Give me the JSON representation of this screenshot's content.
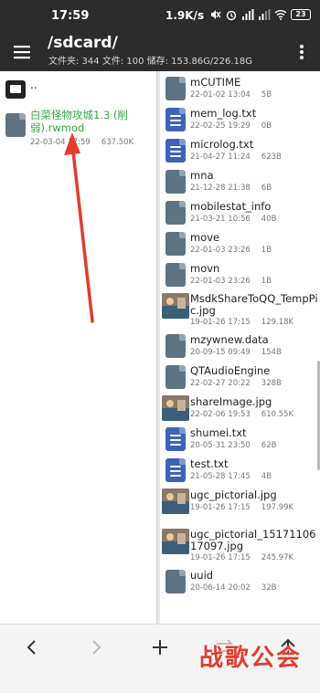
{
  "status_bar": {
    "time": "17:59",
    "net_speed": "1.9K/s",
    "battery": "23"
  },
  "app_bar": {
    "path": "/sdcard/",
    "storage_info": "文件夹: 344   文件: 100   储存: 153.86G/226.18G"
  },
  "left_panel": {
    "parent_label": "..",
    "file": {
      "name": "白菜怪物攻城1.3 (削弱).rwmod",
      "date": "22-03-04 17:59",
      "size": "637.50K"
    }
  },
  "right_panel": {
    "files": [
      {
        "name": "mCUTIME",
        "date": "22-01-02 13:04",
        "size": "5B",
        "icon": "plain"
      },
      {
        "name": "mem_log.txt",
        "date": "22-02-25 19:29",
        "size": "0B",
        "icon": "text"
      },
      {
        "name": "microlog.txt",
        "date": "21-04-27 11:24",
        "size": "623B",
        "icon": "text"
      },
      {
        "name": "mna",
        "date": "21-12-28 21:38",
        "size": "6B",
        "icon": "plain"
      },
      {
        "name": "mobilestat_info",
        "date": "21-03-21 10:56",
        "size": "40B",
        "icon": "plain"
      },
      {
        "name": "move",
        "date": "22-01-03 23:26",
        "size": "1B",
        "icon": "plain"
      },
      {
        "name": "movn",
        "date": "22-01-03 23:26",
        "size": "1B",
        "icon": "plain"
      },
      {
        "name": "MsdkShareToQQ_TempPic.jpg",
        "date": "19-01-26 17:15",
        "size": "129.18K",
        "icon": "image"
      },
      {
        "name": "mzywnew.data",
        "date": "20-09-15 09:49",
        "size": "154B",
        "icon": "plain"
      },
      {
        "name": "QTAudioEngine",
        "date": "22-02-27 20:22",
        "size": "328B",
        "icon": "plain"
      },
      {
        "name": "shareImage.jpg",
        "date": "22-02-06 19:53",
        "size": "610.55K",
        "icon": "image"
      },
      {
        "name": "shumei.txt",
        "date": "20-05-31 23:50",
        "size": "62B",
        "icon": "text"
      },
      {
        "name": "test.txt",
        "date": "21-05-28 17:45",
        "size": "4B",
        "icon": "text"
      },
      {
        "name": "ugc_pictorial.jpg",
        "date": "19-01-26 17:15",
        "size": "197.99K",
        "icon": "image"
      },
      {
        "name": "ugc_pictorial_1517110617097.jpg",
        "date": "19-01-26 17:15",
        "size": "245.97K",
        "icon": "image"
      },
      {
        "name": "uuid",
        "date": "20-06-14 20:02",
        "size": "32B",
        "icon": "plain"
      }
    ]
  },
  "watermark": "战歌公会",
  "colors": {
    "bar_bg": "#2c2c2c",
    "text_file_icon": "#3d63b9",
    "plain_file_icon": "#5f7382",
    "highlight_green": "#36a845",
    "annotation_red": "#e23d2f"
  }
}
